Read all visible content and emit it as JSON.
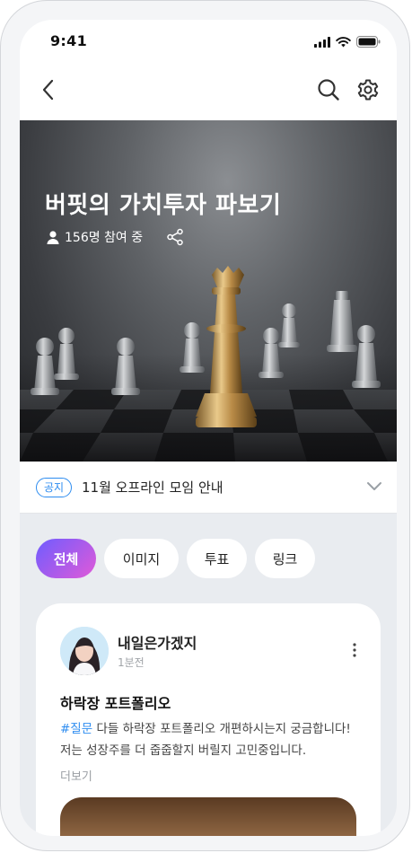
{
  "status_bar": {
    "time": "9:41"
  },
  "nav": {
    "back_icon": "chevron-left-icon",
    "search_icon": "search-icon",
    "settings_icon": "gear-icon"
  },
  "hero": {
    "title": "버핏의 가치투자 파보기",
    "participants": "156명 참여 중",
    "user_icon": "user-icon",
    "share_icon": "share-icon"
  },
  "notice": {
    "badge": "공지",
    "text": "11월 오프라인 모임 안내",
    "chevron_icon": "chevron-down-icon"
  },
  "filters": {
    "chips": [
      {
        "label": "전체",
        "active": true
      },
      {
        "label": "이미지",
        "active": false
      },
      {
        "label": "투표",
        "active": false
      },
      {
        "label": "링크",
        "active": false
      }
    ]
  },
  "post": {
    "author": "내일은가겠지",
    "time": "1분전",
    "title": "하락장 포트폴리오",
    "tag": "#질문",
    "body": " 다들 하락장 포트폴리오 개편하시는지 궁금합니다! 저는 성장주를 더 줍줍할지 버릴지 고민중입니다.",
    "read_more": "더보기",
    "more_icon": "more-vertical-icon"
  },
  "colors": {
    "accent_blue": "#2d8cf0",
    "chip_gradient_start": "#6f5cff",
    "chip_gradient_end": "#e05ad8"
  }
}
